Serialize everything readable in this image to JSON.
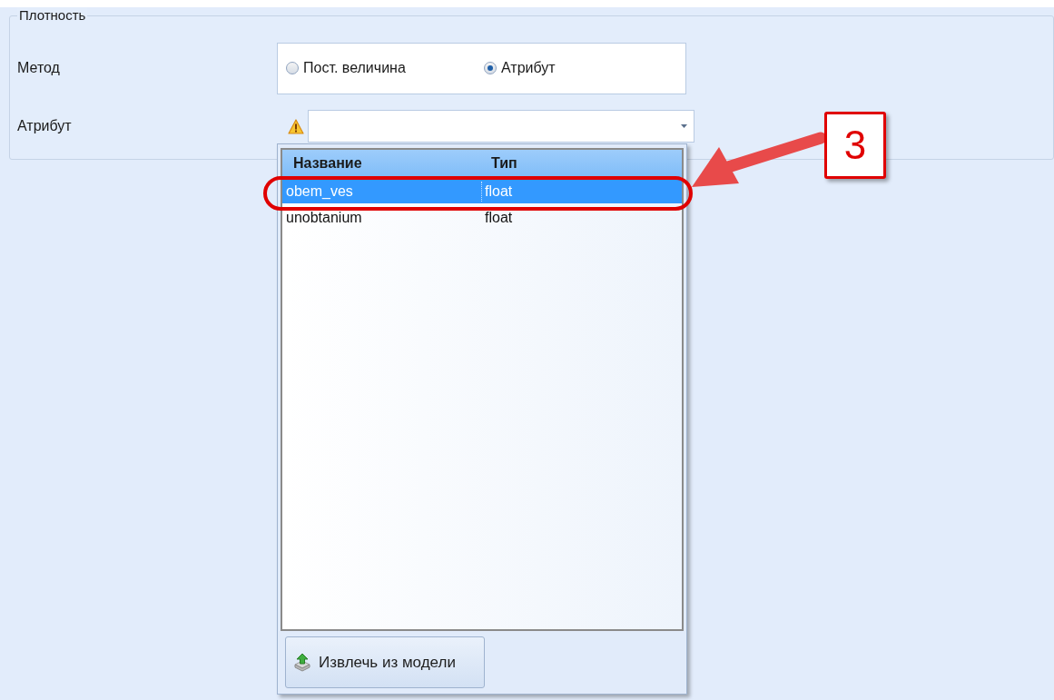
{
  "group": {
    "title": "Плотность"
  },
  "method": {
    "label": "Метод",
    "options": [
      {
        "label": "Пост. величина",
        "selected": false
      },
      {
        "label": "Атрибут",
        "selected": true
      }
    ]
  },
  "attribute": {
    "label": "Атрибут",
    "warning": true,
    "expanded": true
  },
  "dropdown": {
    "columns": [
      "Название",
      "Тип"
    ],
    "rows": [
      {
        "cells": [
          "obem_ves",
          "float"
        ],
        "selected": true
      },
      {
        "cells": [
          "unobtanium",
          "float"
        ],
        "selected": false
      }
    ],
    "button": "Извлечь из модели"
  },
  "annotation": {
    "number": "3"
  }
}
